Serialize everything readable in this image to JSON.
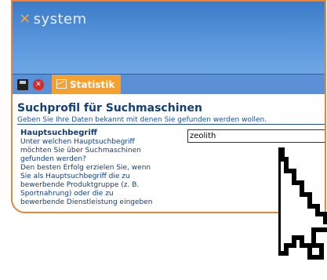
{
  "app": {
    "logo_text": "system"
  },
  "toolbar": {
    "tab_label": "Statistik"
  },
  "form": {
    "title": "Suchprofil für Suchmaschinen",
    "subtitle": "Geben Sie Ihre Daten bekannt mit denen Sie gefunden werden wollen.",
    "field_label": "Hauptsuchbegriff",
    "field_value": "zeolith",
    "help_lines": [
      "Unter welchen Hauptsuchbegriff",
      "möchten Sie über Suchmaschinen",
      "gefunden werden?",
      "Den besten Erfolg erzielen Sie, wenn",
      "Sie als Hauptsuchbegriff die zu",
      "bewerbende Produktgruppe (z. B.",
      "Sportnahrung) oder die zu",
      "bewerbende Dienstleistung eingeben"
    ]
  },
  "colors": {
    "header": "#4a88d4",
    "accent": "#f5a132",
    "text": "#123e7a"
  },
  "icons": [
    "save-icon",
    "close-icon",
    "chart-icon",
    "mouse-cursor-icon"
  ]
}
